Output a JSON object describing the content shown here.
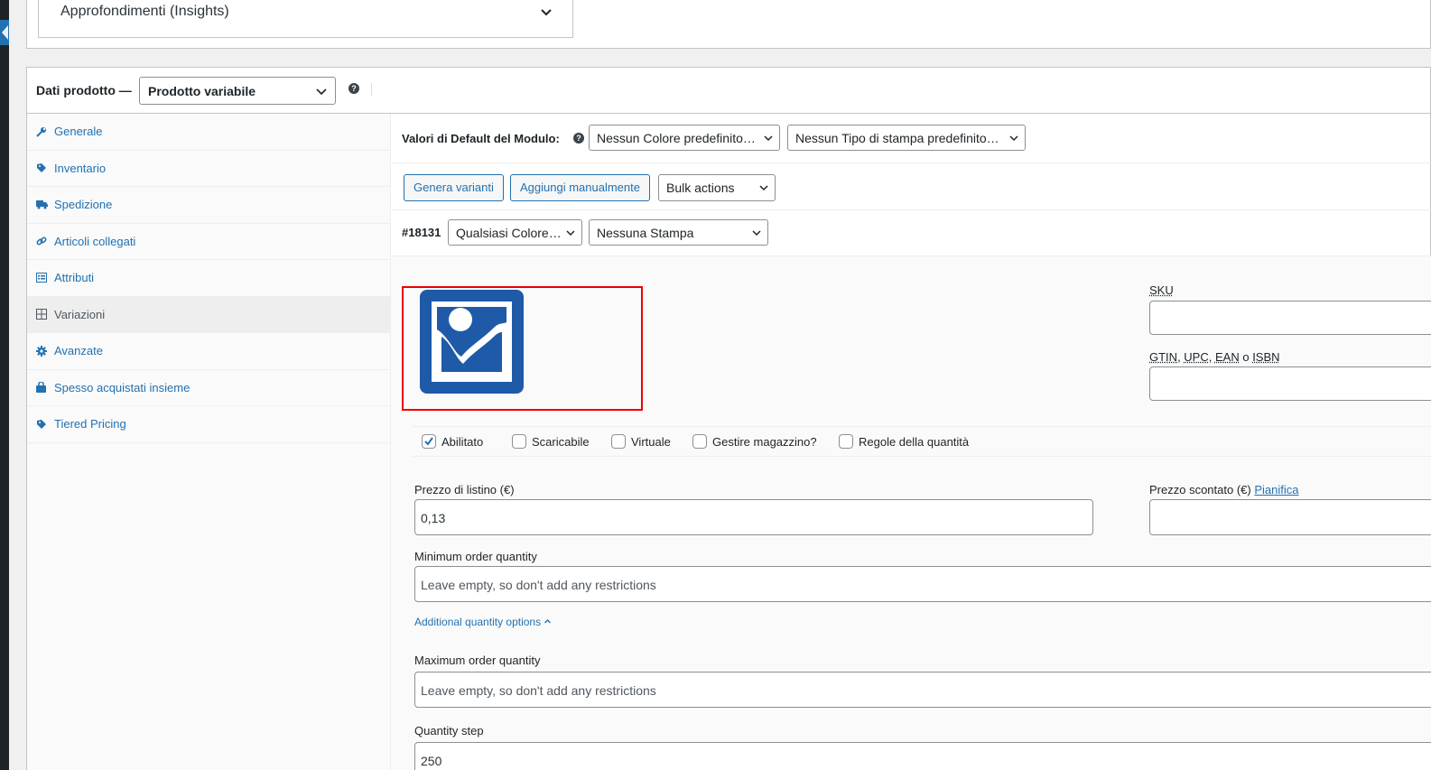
{
  "insights": {
    "label": "Approfondimenti (Insights)"
  },
  "product_data": {
    "title": "Dati prodotto —",
    "type_select": "Prodotto variabile",
    "help": "?"
  },
  "tabs": [
    {
      "label": "Generale",
      "icon": "wrench-icon"
    },
    {
      "label": "Inventario",
      "icon": "tag-icon"
    },
    {
      "label": "Spedizione",
      "icon": "truck-icon"
    },
    {
      "label": "Articoli collegati",
      "icon": "link-icon"
    },
    {
      "label": "Attributi",
      "icon": "list-icon"
    },
    {
      "label": "Variazioni",
      "icon": "grid-icon"
    },
    {
      "label": "Avanzate",
      "icon": "gear-icon"
    },
    {
      "label": "Spesso acquistati insieme",
      "icon": "bag-icon"
    },
    {
      "label": "Tiered Pricing",
      "icon": "tag-icon"
    }
  ],
  "defaults_row": {
    "label": "Valori di Default del Modulo:",
    "color_select": "Nessun Colore predefinito…",
    "print_select": "Nessun Tipo di stampa predefinito…"
  },
  "actions_row": {
    "generate": "Genera varianti",
    "add_manual": "Aggiungi manualmente",
    "bulk": "Bulk actions"
  },
  "variation": {
    "id": "#18131",
    "color_select": "Qualsiasi Colore…",
    "print_select": "Nessuna Stampa"
  },
  "fields": {
    "sku_label": "SKU",
    "gtin_label_parts": [
      "GTIN",
      ", ",
      "UPC",
      ", ",
      "EAN",
      " o ",
      "ISBN"
    ],
    "checkboxes": [
      {
        "label": "Abilitato",
        "checked": true
      },
      {
        "label": "Scaricabile",
        "checked": false
      },
      {
        "label": "Virtuale",
        "checked": false
      },
      {
        "label": "Gestire magazzino?",
        "checked": false
      },
      {
        "label": "Regole della quantità",
        "checked": false
      }
    ],
    "price_label": "Prezzo di listino (€)",
    "price_value": "0,13",
    "sale_label": "Prezzo scontato (€)",
    "sale_link": "Pianifica",
    "min_qty_label": "Minimum order quantity",
    "min_qty_placeholder": "Leave empty, so don't add any restrictions",
    "additional_link": "Additional quantity options",
    "max_qty_label": "Maximum order quantity",
    "max_qty_placeholder": "Leave empty, so don't add any restrictions",
    "step_label": "Quantity step",
    "step_value": "250"
  },
  "colors": {
    "accent": "#2271b1",
    "image_icon": "#1e5aa8",
    "highlight": "#e00000"
  }
}
